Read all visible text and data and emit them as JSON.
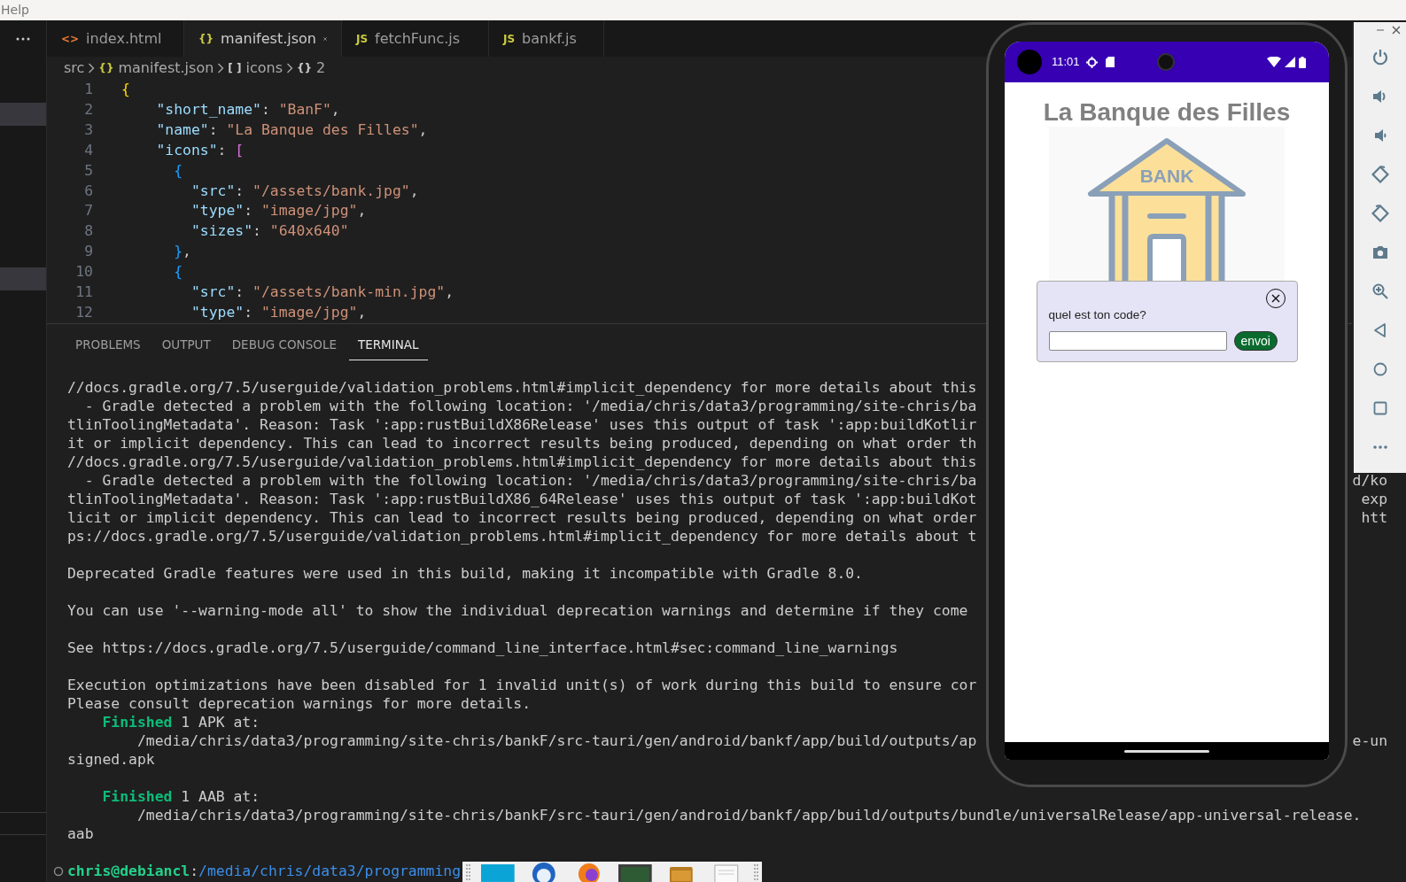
{
  "menubar": {
    "items": [
      "Help"
    ]
  },
  "editor": {
    "tabs": [
      {
        "label": "index.html",
        "kind": "html",
        "icon_text": "<>",
        "selected": false
      },
      {
        "label": "manifest.json",
        "kind": "json",
        "icon_text": "{}",
        "selected": true
      },
      {
        "label": "fetchFunc.js",
        "kind": "js",
        "icon_text": "JS",
        "selected": false
      },
      {
        "label": "bankf.js",
        "kind": "js",
        "icon_text": "JS",
        "selected": false
      }
    ],
    "breadcrumb": [
      {
        "label": "src"
      },
      {
        "label": "manifest.json",
        "kind": "json",
        "icon_text": "{}"
      },
      {
        "label": "icons",
        "kind": "array",
        "icon_text": "[ ]"
      },
      {
        "label": "2",
        "kind": "object",
        "icon_text": "{}"
      }
    ],
    "lines": [
      {
        "number": "1",
        "tokens": [
          {
            "text": "{",
            "kind": "b1"
          }
        ]
      },
      {
        "number": "2",
        "tokens": [
          {
            "text": "    \"short_name\"",
            "kind": "key"
          },
          {
            "text": ": ",
            "kind": "p"
          },
          {
            "text": "\"BanF\"",
            "kind": "str"
          },
          {
            "text": ",",
            "kind": "p"
          }
        ]
      },
      {
        "number": "3",
        "tokens": [
          {
            "text": "    \"name\"",
            "kind": "key"
          },
          {
            "text": ": ",
            "kind": "p"
          },
          {
            "text": "\"La Banque des Filles\"",
            "kind": "str"
          },
          {
            "text": ",",
            "kind": "p"
          }
        ]
      },
      {
        "number": "4",
        "tokens": [
          {
            "text": "    \"icons\"",
            "kind": "key"
          },
          {
            "text": ": ",
            "kind": "p"
          },
          {
            "text": "[",
            "kind": "b2"
          }
        ]
      },
      {
        "number": "5",
        "tokens": [
          {
            "text": "      {",
            "kind": "b3"
          }
        ]
      },
      {
        "number": "6",
        "tokens": [
          {
            "text": "        \"src\"",
            "kind": "key"
          },
          {
            "text": ": ",
            "kind": "p"
          },
          {
            "text": "\"/assets/bank.jpg\"",
            "kind": "str"
          },
          {
            "text": ",",
            "kind": "p"
          }
        ]
      },
      {
        "number": "7",
        "tokens": [
          {
            "text": "        \"type\"",
            "kind": "key"
          },
          {
            "text": ": ",
            "kind": "p"
          },
          {
            "text": "\"image/jpg\"",
            "kind": "str"
          },
          {
            "text": ",",
            "kind": "p"
          }
        ]
      },
      {
        "number": "8",
        "tokens": [
          {
            "text": "        \"sizes\"",
            "kind": "key"
          },
          {
            "text": ": ",
            "kind": "p"
          },
          {
            "text": "\"640x640\"",
            "kind": "str"
          }
        ]
      },
      {
        "number": "9",
        "tokens": [
          {
            "text": "      }",
            "kind": "b3"
          },
          {
            "text": ",",
            "kind": "p"
          }
        ]
      },
      {
        "number": "10",
        "tokens": [
          {
            "text": "      {",
            "kind": "b3"
          }
        ]
      },
      {
        "number": "11",
        "tokens": [
          {
            "text": "        \"src\"",
            "kind": "key"
          },
          {
            "text": ": ",
            "kind": "p"
          },
          {
            "text": "\"/assets/bank-min.jpg\"",
            "kind": "str"
          },
          {
            "text": ",",
            "kind": "p"
          }
        ]
      },
      {
        "number": "12",
        "tokens": [
          {
            "text": "        \"type\"",
            "kind": "key"
          },
          {
            "text": ": ",
            "kind": "p"
          },
          {
            "text": "\"image/jpg\"",
            "kind": "str"
          },
          {
            "text": ",",
            "kind": "p"
          }
        ]
      }
    ]
  },
  "panel": {
    "tabs": [
      {
        "label": "PROBLEMS",
        "selected": false
      },
      {
        "label": "OUTPUT",
        "selected": false
      },
      {
        "label": "DEBUG CONSOLE",
        "selected": false
      },
      {
        "label": "TERMINAL",
        "selected": true
      }
    ],
    "terminal": {
      "blocks": [
        [
          {
            "text": "//docs.gradle.org/7.5/userguide/validation_problems.html#implicit_dependency for more details about this"
          },
          {
            "text": "  - Gradle detected a problem with the following location: '/media/chris/data3/programming/site-chris/ba"
          },
          {
            "text": "tlinToolingMetadata'. Reason: Task ':app:rustBuildX86Release' uses this output of task ':app:buildKotlir"
          },
          {
            "text": "it or implicit dependency. This can lead to incorrect results being produced, depending on what order th"
          },
          {
            "text": "//docs.gradle.org/7.5/userguide/validation_problems.html#implicit_dependency for more details about this"
          },
          {
            "text": "  - Gradle detected a problem with the following location: '/media/chris/data3/programming/site-chris/ba",
            "right": "d/ko"
          },
          {
            "text": "tlinToolingMetadata'. Reason: Task ':app:rustBuildX86_64Release' uses this output of task ':app:buildKot",
            "right": " exp"
          },
          {
            "text": "licit or implicit dependency. This can lead to incorrect results being produced, depending on what order",
            "right": " htt"
          },
          {
            "text": "ps://docs.gradle.org/7.5/userguide/validation_problems.html#implicit_dependency for more details about t"
          }
        ],
        [
          {
            "text": "Deprecated Gradle features were used in this build, making it incompatible with Gradle 8.0."
          }
        ],
        [
          {
            "text": "You can use '--warning-mode all' to show the individual deprecation warnings and determine if they come"
          }
        ],
        [
          {
            "text": "See https://docs.gradle.org/7.5/userguide/command_line_interface.html#sec:command_line_warnings"
          }
        ],
        [
          {
            "text": "Execution optimizations have been disabled for 1 invalid unit(s) of work during this build to ensure cor"
          },
          {
            "text": "Please consult deprecation warnings for more details."
          },
          {
            "kind": "status",
            "status": "Finished",
            "text": " 1 APK at:"
          },
          {
            "text": "        /media/chris/data3/programming/site-chris/bankF/src-tauri/gen/android/bankf/app/build/outputs/ap",
            "right": "e-un"
          },
          {
            "text": "signed.apk"
          }
        ],
        [
          {
            "kind": "status",
            "status": "Finished",
            "text": " 1 AAB at:"
          },
          {
            "text": "        /media/chris/data3/programming/site-chris/bankF/src-tauri/gen/android/bankf/app/build/outputs/bundle/universalRelease/app-universal-release."
          },
          {
            "text": "aab"
          }
        ]
      ],
      "prompt": {
        "user": "chris@debiancl",
        "separator": ":",
        "path": "/media/chris/data3/programming"
      }
    }
  },
  "emulator": {
    "status_bar": {
      "time": "11:01"
    },
    "app": {
      "title": "La Banque des Filles",
      "image_text": "BANK",
      "dialog": {
        "label": "quel est ton code?",
        "button": "envoi"
      }
    }
  }
}
